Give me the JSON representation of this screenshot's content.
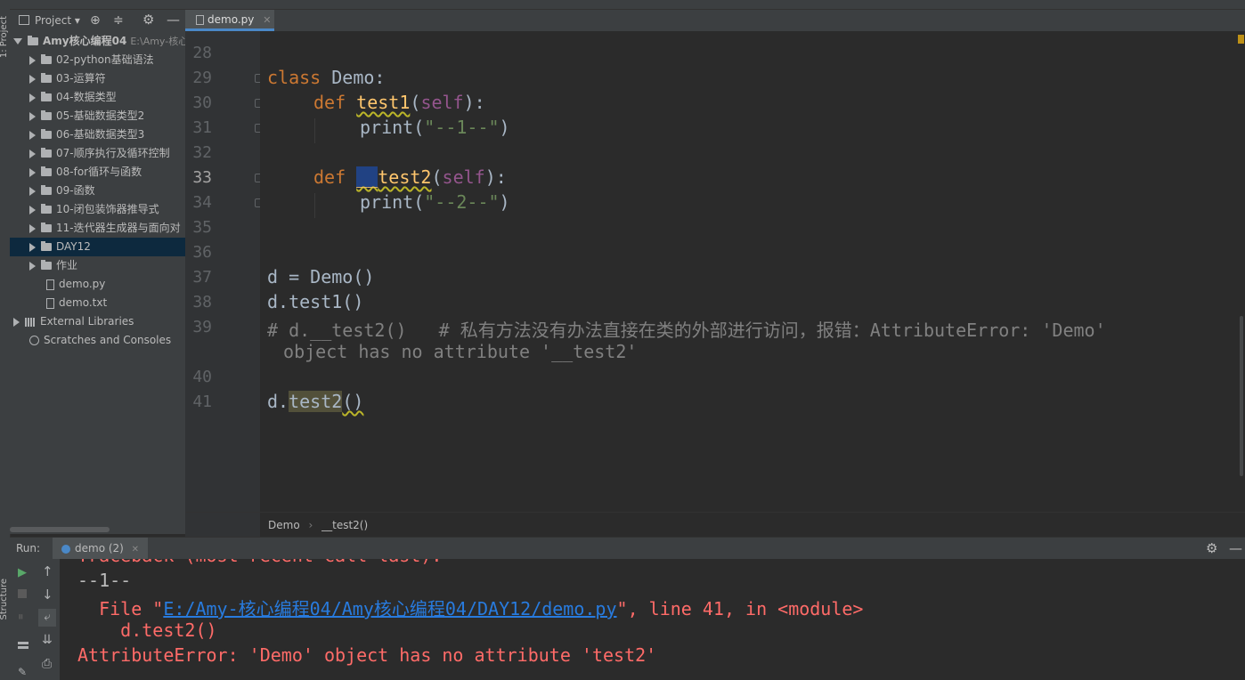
{
  "project_panel": {
    "title": "Project",
    "items": [
      {
        "label": "Amy核心编程04",
        "path": "E:\\Amy-核心",
        "type": "root"
      },
      {
        "label": "02-python基础语法",
        "type": "folder"
      },
      {
        "label": "03-运算符",
        "type": "folder"
      },
      {
        "label": "04-数据类型",
        "type": "folder"
      },
      {
        "label": "05-基础数据类型2",
        "type": "folder"
      },
      {
        "label": "06-基础数据类型3",
        "type": "folder"
      },
      {
        "label": "07-顺序执行及循环控制",
        "type": "folder"
      },
      {
        "label": "08-for循环与函数",
        "type": "folder"
      },
      {
        "label": "09-函数",
        "type": "folder"
      },
      {
        "label": "10-闭包装饰器推导式",
        "type": "folder"
      },
      {
        "label": "11-迭代器生成器与面向对",
        "type": "folder"
      },
      {
        "label": "DAY12",
        "type": "folder",
        "selected": true
      },
      {
        "label": "作业",
        "type": "folder"
      },
      {
        "label": "demo.py",
        "type": "file"
      },
      {
        "label": "demo.txt",
        "type": "file"
      },
      {
        "label": "External Libraries",
        "type": "lib"
      },
      {
        "label": "Scratches and Consoles",
        "type": "scratch"
      }
    ]
  },
  "tool_strip": {
    "project_label": "1: Project",
    "structure_label": "Structure"
  },
  "editor": {
    "tab": "demo.py",
    "lines": [
      {
        "n": "28"
      },
      {
        "n": "29",
        "kw": "class",
        "name": " Demo:"
      },
      {
        "n": "30",
        "kw": "def",
        "fn": "test1",
        "self": "self",
        "end": "):"
      },
      {
        "n": "31",
        "call": "print(",
        "str": "\"--1--\"",
        "close": ")"
      },
      {
        "n": "32"
      },
      {
        "n": "33",
        "kw": "def",
        "priv": "__",
        "fn": "test2",
        "self": "self",
        "end": "):"
      },
      {
        "n": "34",
        "call": "print(",
        "str": "\"--2--\"",
        "close": ")"
      },
      {
        "n": "35"
      },
      {
        "n": "36"
      },
      {
        "n": "37",
        "text": "d = Demo()"
      },
      {
        "n": "38",
        "text": "d.test1()"
      },
      {
        "n": "39",
        "comment": "# d.__test2()   # 私有方法没有办法直接在类的外部进行访问，报错：AttributeError: 'Demo'",
        "comment2": " object has no attribute '__test2'"
      },
      {
        "n": "40"
      },
      {
        "n": "41",
        "pre": "d.",
        "method": "test2",
        "post": "()"
      }
    ]
  },
  "breadcrumb": {
    "class_name": "Demo",
    "sep": "›",
    "method_name": "__test2()"
  },
  "run_panel": {
    "label": "Run:",
    "tab": "demo (2)",
    "lines": {
      "traceback": "Traceback (most recent call last):",
      "output1": "--1--",
      "file_prefix": "  File \"",
      "file_path": "E:/Amy-核心编程04/Amy核心编程04/DAY12/demo.py",
      "file_suffix": "\", line 41, in <module>",
      "code": "    d.test2()",
      "error": "AttributeError: 'Demo' object has no attribute 'test2'"
    }
  },
  "colors": {
    "keyword": "#cc7832",
    "function": "#ffc66d",
    "string": "#6a8759",
    "comment": "#808080",
    "error": "#ff6b68",
    "link": "#287bde"
  }
}
